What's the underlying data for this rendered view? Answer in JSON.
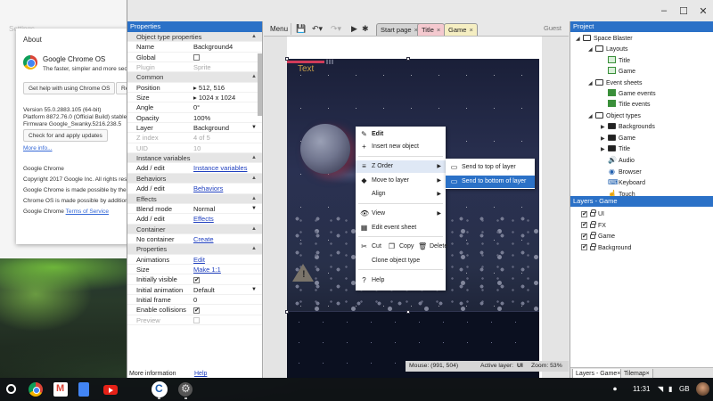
{
  "settings": {
    "title": "Settings",
    "about": {
      "title": "About",
      "product_name": "Google Chrome OS",
      "tagline": "The faster, simpler and more secure",
      "help_button": "Get help with using Chrome OS",
      "report_button": "Re",
      "version": "Version 55.0.2883.105 (64-bit)",
      "platform": "Platform 8872.76.0 (Official Build) stable-",
      "firmware": "Firmware Google_Swanky.5216.238.5",
      "update_button": "Check for and apply updates",
      "more_info": "More info...",
      "footer_name": "Google Chrome",
      "copyright": "Copyright 2017 Google Inc. All rights reserve",
      "made_possible_1": "Google Chrome is made possible by the C",
      "made_possible_2": "Chrome OS is made possible by additiona",
      "tos_prefix": "Google Chrome",
      "tos_link": "Terms of Service"
    }
  },
  "app": {
    "window_controls": [
      "–",
      "☐",
      "✕"
    ],
    "toolbar": {
      "menu_label": "Menu",
      "tabs": [
        {
          "label": "Start page",
          "color": "#d4d4d4"
        },
        {
          "label": "Title",
          "color": "#f4c9cf"
        },
        {
          "label": "Game",
          "color": "#f5eec2"
        }
      ],
      "tab_close": "×",
      "user": "Guest"
    },
    "properties": {
      "panel_title": "Properties",
      "rows": [
        {
          "kind": "section",
          "label": "Object type properties"
        },
        {
          "kind": "prop",
          "key": "Name",
          "value": "Background4"
        },
        {
          "kind": "check",
          "key": "Global",
          "checked": false
        },
        {
          "kind": "prop",
          "key": "Plugin",
          "value": "Sprite",
          "dim": true
        },
        {
          "kind": "section",
          "label": "Common"
        },
        {
          "kind": "prop",
          "key": "Position",
          "value": "▸ 512, 516"
        },
        {
          "kind": "prop",
          "key": "Size",
          "value": "▸ 1024 x 1024"
        },
        {
          "kind": "prop",
          "key": "Angle",
          "value": "0°"
        },
        {
          "kind": "prop",
          "key": "Opacity",
          "value": "100%"
        },
        {
          "kind": "dropdown",
          "key": "Layer",
          "value": "Background"
        },
        {
          "kind": "prop",
          "key": "Z index",
          "value": "4 of 5",
          "dim": true
        },
        {
          "kind": "prop",
          "key": "UID",
          "value": "10",
          "dim": true
        },
        {
          "kind": "section",
          "label": "Instance variables"
        },
        {
          "kind": "link",
          "key": "Add / edit",
          "value": "Instance variables"
        },
        {
          "kind": "section",
          "label": "Behaviors"
        },
        {
          "kind": "link",
          "key": "Add / edit",
          "value": "Behaviors"
        },
        {
          "kind": "section",
          "label": "Effects"
        },
        {
          "kind": "dropdown",
          "key": "Blend mode",
          "value": "Normal"
        },
        {
          "kind": "link",
          "key": "Add / edit",
          "value": "Effects"
        },
        {
          "kind": "section",
          "label": "Container"
        },
        {
          "kind": "link",
          "key": "No container",
          "value": "Create"
        },
        {
          "kind": "section",
          "label": "Properties"
        },
        {
          "kind": "link",
          "key": "Animations",
          "value": "Edit"
        },
        {
          "kind": "link",
          "key": "Size",
          "value": "Make 1:1"
        },
        {
          "kind": "check",
          "key": "Initially visible",
          "checked": true
        },
        {
          "kind": "dropdown",
          "key": "Initial animation",
          "value": "Default"
        },
        {
          "kind": "prop",
          "key": "Initial frame",
          "value": "0"
        },
        {
          "kind": "check",
          "key": "Enable collisions",
          "checked": true
        },
        {
          "kind": "check",
          "key": "Preview",
          "checked": false,
          "dim": true
        }
      ],
      "footer_label": "More information",
      "footer_link": "Help"
    },
    "canvas": {
      "hud_lives": "iii",
      "hud_text": "Text"
    },
    "statusbar": {
      "mouse": "Mouse: (991, 504)",
      "active_layer_label": "Active layer:",
      "active_layer": "UI",
      "zoom": "Zoom: 53%"
    },
    "context_menu": {
      "items": [
        {
          "label": "Edit",
          "icon": "✎",
          "bold": true
        },
        {
          "label": "Insert new object",
          "icon": "+"
        },
        {
          "label": "Z Order",
          "icon": "≡",
          "submenu": true
        },
        {
          "label": "Move to layer",
          "icon": "◆",
          "submenu": true
        },
        {
          "label": "Align",
          "icon": "",
          "submenu": true
        },
        {
          "label": "View",
          "icon": "👁",
          "submenu": true
        },
        {
          "label": "Edit event sheet",
          "icon": "▦"
        },
        {
          "label": "Cut",
          "icon": "✂"
        },
        {
          "label": "Copy",
          "icon": "❐"
        },
        {
          "label": "Delete",
          "icon": "🗑"
        },
        {
          "label": "Clone object type",
          "icon": ""
        },
        {
          "label": "Help",
          "icon": "?"
        }
      ],
      "submenu": [
        "Send to top of layer",
        "Send to bottom of layer"
      ]
    },
    "project": {
      "panel_title": "Project",
      "tree": [
        {
          "label": "Space Blaster",
          "type": "folder",
          "indent": 0,
          "twisty": "◢"
        },
        {
          "label": "Layouts",
          "type": "folder",
          "indent": 1,
          "twisty": "◢"
        },
        {
          "label": "Title",
          "type": "layout",
          "indent": 2,
          "twisty": ""
        },
        {
          "label": "Game",
          "type": "layout",
          "indent": 2,
          "twisty": ""
        },
        {
          "label": "Event sheets",
          "type": "folder",
          "indent": 1,
          "twisty": "◢"
        },
        {
          "label": "Game events",
          "type": "events",
          "indent": 2,
          "twisty": ""
        },
        {
          "label": "Title events",
          "type": "events",
          "indent": 2,
          "twisty": ""
        },
        {
          "label": "Object types",
          "type": "folder",
          "indent": 1,
          "twisty": "◢"
        },
        {
          "label": "Backgrounds",
          "type": "folder-dark",
          "indent": 2,
          "twisty": "▶"
        },
        {
          "label": "Game",
          "type": "folder-dark",
          "indent": 2,
          "twisty": "▶"
        },
        {
          "label": "Title",
          "type": "folder-dark",
          "indent": 2,
          "twisty": "▶"
        },
        {
          "label": "Audio",
          "type": "object",
          "indent": 2,
          "twisty": "",
          "icon": "🔊"
        },
        {
          "label": "Browser",
          "type": "object",
          "indent": 2,
          "twisty": "",
          "icon": "◉"
        },
        {
          "label": "Keyboard",
          "type": "object",
          "indent": 2,
          "twisty": "",
          "icon": "⌨"
        },
        {
          "label": "Touch",
          "type": "object",
          "indent": 2,
          "twisty": "",
          "icon": "☝"
        }
      ]
    },
    "layers": {
      "panel_title": "Layers - Game",
      "items": [
        "UI",
        "FX",
        "Game",
        "Background"
      ],
      "bottom_tabs": [
        "Layers - Game",
        "Tilemap"
      ]
    }
  },
  "tray": {
    "time": "11:31",
    "locale": "GB"
  },
  "colors": {
    "accent": "#2b71c7",
    "selected_menu": "#2b71c7"
  }
}
